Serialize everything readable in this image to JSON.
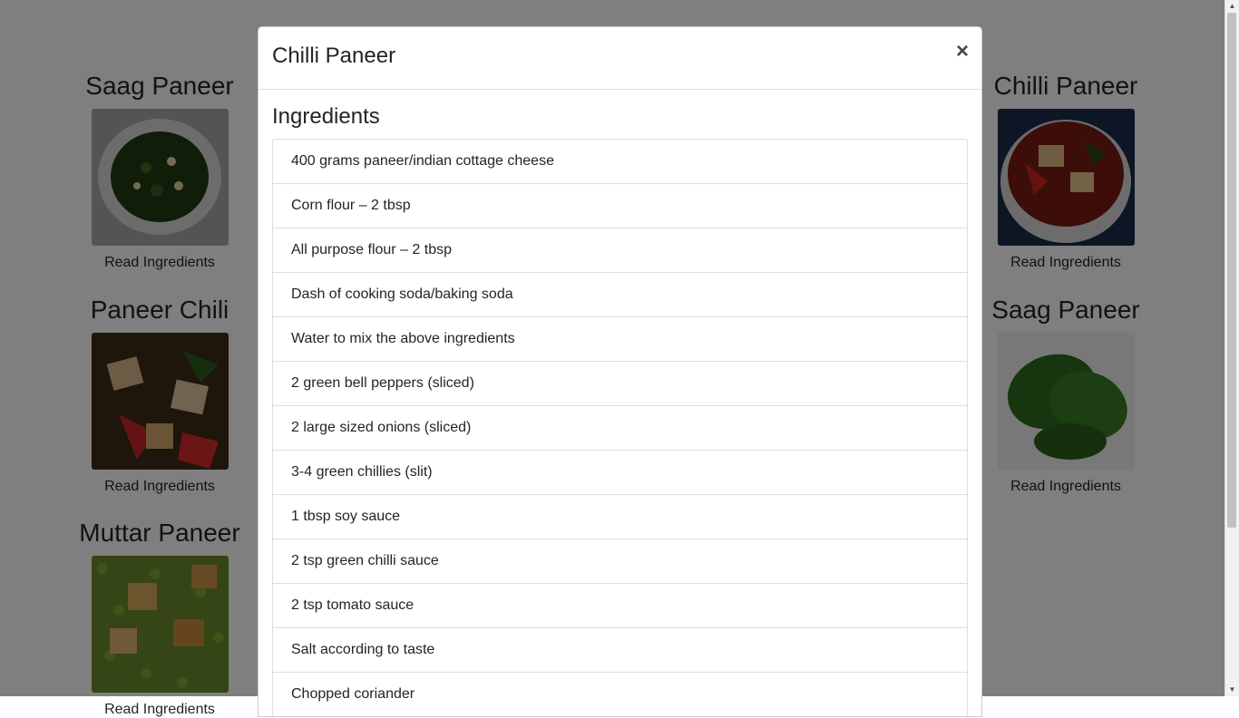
{
  "recipes_left": [
    {
      "title": "Saag Paneer",
      "link": "Read Ingredients",
      "image": "saag-paneer-bowl"
    },
    {
      "title": "Paneer Chili",
      "link": "Read Ingredients",
      "image": "paneer-chili"
    },
    {
      "title": "Muttar Paneer",
      "link": "Read Ingredients",
      "image": "muttar-paneer"
    }
  ],
  "recipes_right": [
    {
      "title": "Chilli Paneer",
      "link": "Read Ingredients",
      "image": "chilli-paneer-bowl"
    },
    {
      "title": "Saag Paneer",
      "link": "Read Ingredients",
      "image": "spinach-leaves"
    }
  ],
  "modal": {
    "title": "Chilli Paneer",
    "close": "×",
    "section_title": "Ingredients",
    "ingredients": [
      "400 grams paneer/indian cottage cheese",
      "Corn flour – 2 tbsp",
      "All purpose flour – 2 tbsp",
      "Dash of cooking soda/baking soda",
      "Water to mix the above ingredients",
      "2 green bell peppers (sliced)",
      "2 large sized onions (sliced)",
      "3-4 green chillies (slit)",
      "1 tbsp soy sauce",
      "2 tsp green chilli sauce",
      "2 tsp tomato sauce",
      "Salt according to taste",
      "Chopped coriander"
    ]
  }
}
